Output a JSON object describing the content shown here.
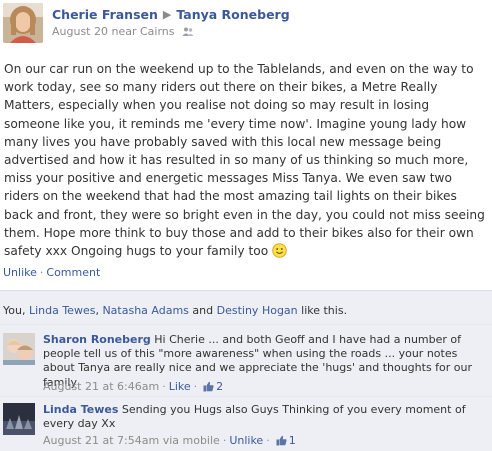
{
  "post": {
    "author": "Cherie Fransen",
    "recipient": "Tanya Roneberg",
    "meta": "August 20 near Cairns",
    "body": "On our car run on the weekend up to the Tablelands, and even on the way to work today, see so many riders out there on their bikes, a Metre Really Matters, especially when you realise not doing so may result in losing someone like you, it reminds me 'every time now'. Imagine young lady how many lives you have probably saved with this local new message being advertised and how it has resulted in so many of us thinking so much more, miss your positive and energetic messages Miss Tanya. We even saw two riders on the weekend that had the most amazing tail lights on their bikes back and front, they were so bright even in the day, you could not miss seeing them. Hope more think to buy those and add to their bikes also for their own safety xxx Ongoing hugs to your family too"
  },
  "actions": {
    "unlike": "Unlike",
    "separator": "·",
    "comment": "Comment"
  },
  "likes": {
    "prefix": "You, ",
    "names": [
      "Linda Tewes",
      "Natasha Adams",
      "Destiny Hogan"
    ],
    "comma": ", ",
    "and": " and ",
    "suffix": " like this."
  },
  "comments": [
    {
      "author": "Sharon Roneberg",
      "text": "Hi Cherie ... and both Geoff and I have had a number of people tell us of this \"more awareness\" when using the roads ... your notes about Tanya are really nice and we appreciate the 'hugs' and thoughts for our family",
      "time": "August 21 at 6:46am",
      "separator": "·",
      "like_label": "Like",
      "like_count": "2"
    },
    {
      "author": "Linda Tewes",
      "text": "Sending you Hugs also Guys Thinking of you every moment of every day Xx",
      "time": "August 21 at 7:54am via mobile",
      "separator": "·",
      "like_label": "Unlike",
      "like_count": "1"
    }
  ],
  "colors": {
    "link": "#3b5998",
    "comment_bg": "#edeff4",
    "meta_gray": "#8c8c8c"
  },
  "icons": [
    "people-icon",
    "smiley-icon",
    "thumbs-up-icon",
    "arrow-icon"
  ]
}
